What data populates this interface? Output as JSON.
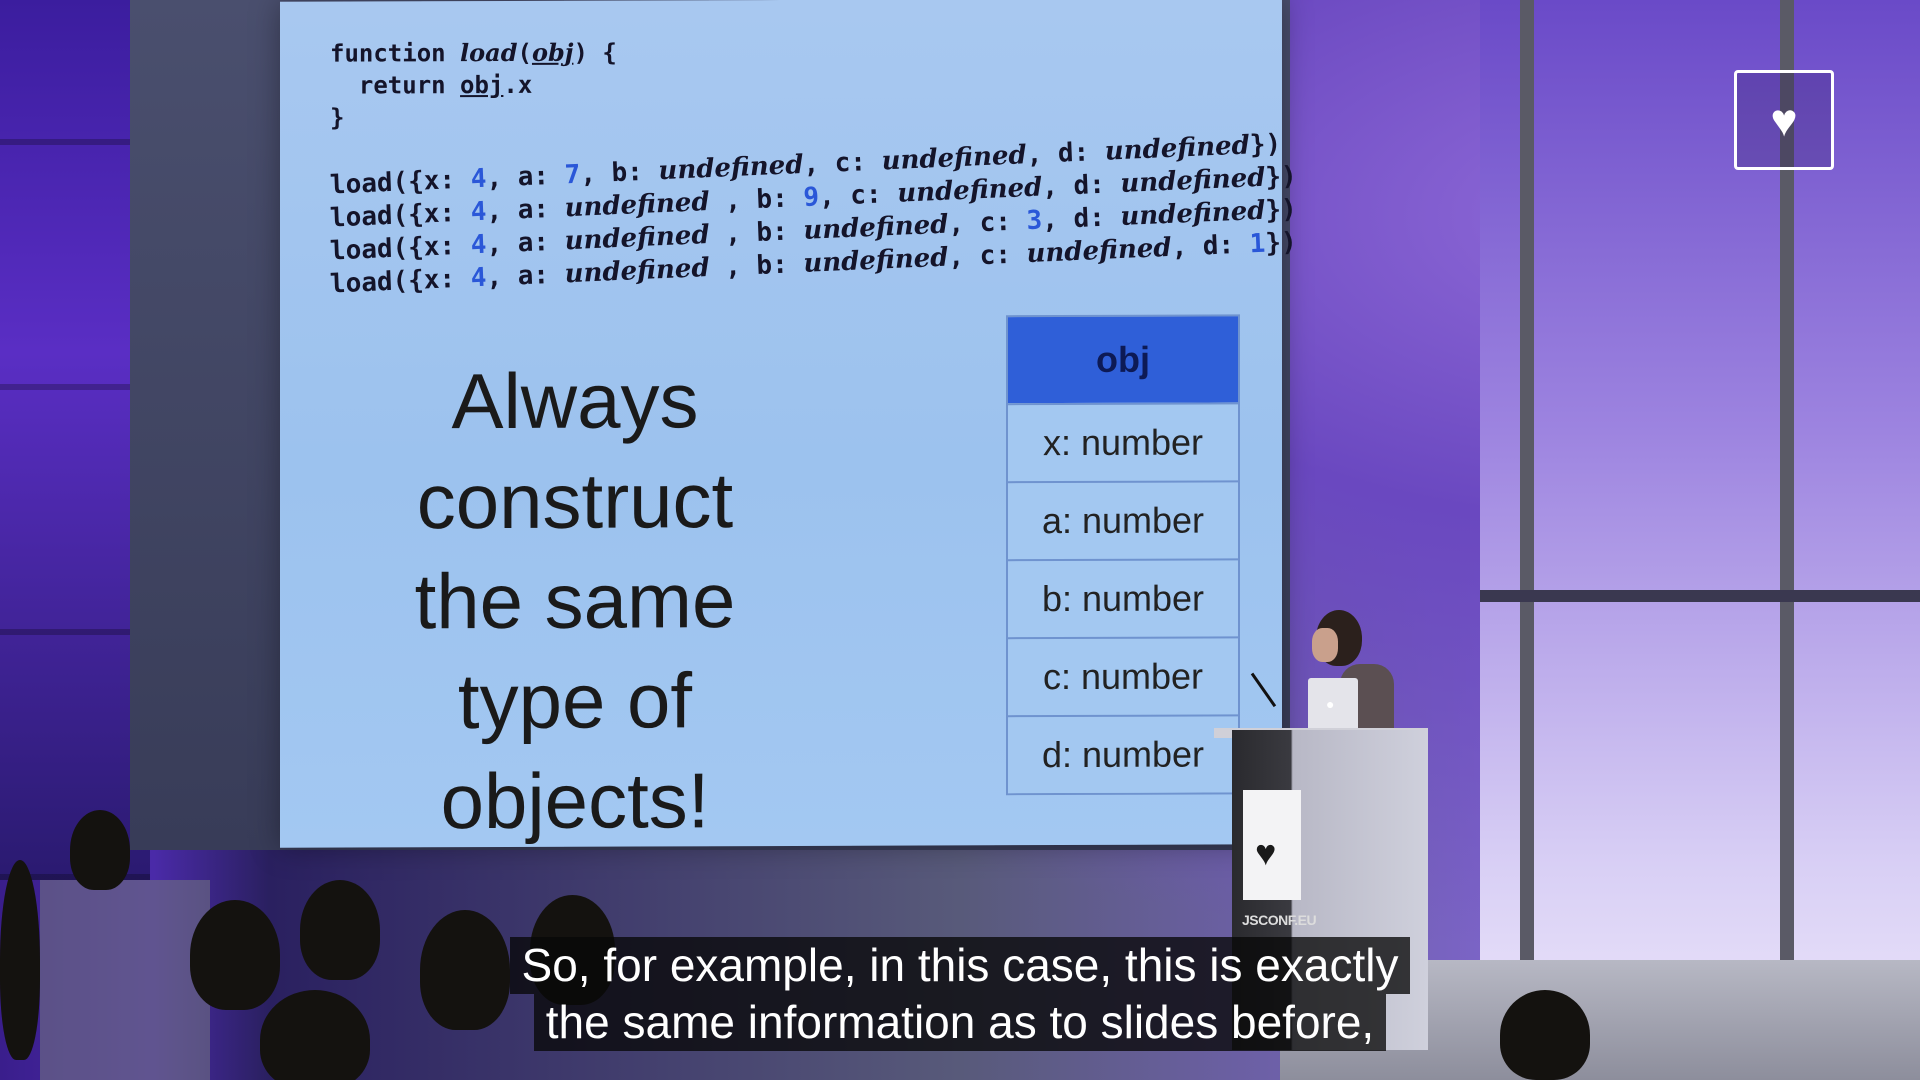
{
  "slide": {
    "code": {
      "fn_line": [
        "function ",
        "load",
        "(",
        "obj",
        ") {"
      ],
      "return_line": [
        "  return ",
        "obj",
        ".x"
      ],
      "close_line": "}",
      "calls": [
        [
          [
            "t",
            "load({x: "
          ],
          [
            "n",
            "4"
          ],
          [
            "t",
            ", a: "
          ],
          [
            "n",
            "7"
          ],
          [
            "t",
            ", b: "
          ],
          [
            "i",
            "undefined"
          ],
          [
            "t",
            ", c: "
          ],
          [
            "i",
            "undefined"
          ],
          [
            "t",
            ", d: "
          ],
          [
            "i",
            "undefined"
          ],
          [
            "t",
            "})"
          ]
        ],
        [
          [
            "t",
            "load({x: "
          ],
          [
            "n",
            "4"
          ],
          [
            "t",
            ", a: "
          ],
          [
            "i",
            "undefined"
          ],
          [
            "t",
            " , b: "
          ],
          [
            "n",
            "9"
          ],
          [
            "t",
            ", c: "
          ],
          [
            "i",
            "undefined"
          ],
          [
            "t",
            ", d: "
          ],
          [
            "i",
            "undefined"
          ],
          [
            "t",
            "})"
          ]
        ],
        [
          [
            "t",
            "load({x: "
          ],
          [
            "n",
            "4"
          ],
          [
            "t",
            ", a: "
          ],
          [
            "i",
            "undefined"
          ],
          [
            "t",
            " , b: "
          ],
          [
            "i",
            "undefined"
          ],
          [
            "t",
            ", c: "
          ],
          [
            "n",
            "3"
          ],
          [
            "t",
            ", d: "
          ],
          [
            "i",
            "undefined"
          ],
          [
            "t",
            "})"
          ]
        ],
        [
          [
            "t",
            "load({x: "
          ],
          [
            "n",
            "4"
          ],
          [
            "t",
            ", a: "
          ],
          [
            "i",
            "undefined"
          ],
          [
            "t",
            " , b: "
          ],
          [
            "i",
            "undefined"
          ],
          [
            "t",
            ", c: "
          ],
          [
            "i",
            "undefined"
          ],
          [
            "t",
            ", d: "
          ],
          [
            "n",
            "1"
          ],
          [
            "t",
            "})"
          ]
        ]
      ]
    },
    "headline": [
      "Always construct",
      "the same type of",
      "objects!"
    ],
    "obj_table": {
      "header": "obj",
      "rows": [
        "x: number",
        "a: number",
        "b: number",
        "c: number",
        "d: number"
      ]
    }
  },
  "podium": {
    "card_icon": "heart-icon",
    "brand_text": "JSCONF.EU"
  },
  "overlay": {
    "like_icon": "heart-icon"
  },
  "caption": {
    "line1": "So, for example, in this case, this is exactly",
    "line2": "the same information as to slides before,"
  },
  "colors": {
    "slide_bg": "#a3c8f2",
    "table_header": "#2f5fd8",
    "code_number": "#2a57d8"
  }
}
